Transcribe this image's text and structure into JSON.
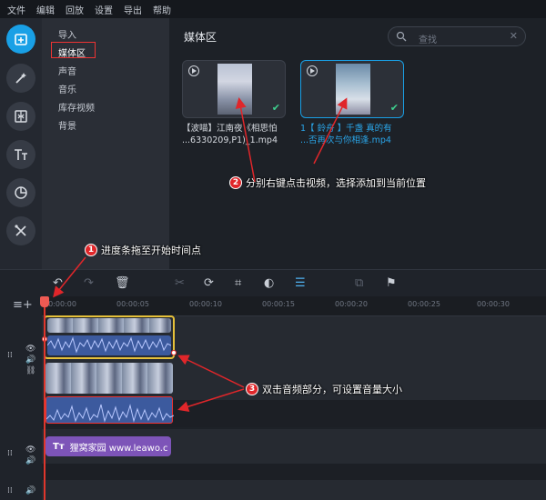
{
  "menu": [
    "文件",
    "编辑",
    "回放",
    "设置",
    "导出",
    "帮助"
  ],
  "toolbar": [
    {
      "name": "import-icon",
      "active": true
    },
    {
      "name": "magic-wand-icon",
      "active": false
    },
    {
      "name": "transitions-icon",
      "active": false
    },
    {
      "name": "titles-icon",
      "active": false
    },
    {
      "name": "filters-icon",
      "active": false
    },
    {
      "name": "tools-icon",
      "active": false
    }
  ],
  "categories": [
    "导入",
    "媒体区",
    "声音",
    "音乐",
    "库存视频",
    "背景"
  ],
  "media": {
    "title": "媒体区",
    "search_placeholder": "查找",
    "clips": [
      {
        "name_line1": "【波喵】江南夜《相思怕",
        "name_line2": "...6330209,P1)_1.mp4"
      },
      {
        "name_line1": "1【 鈴舟 】千盏 真的有",
        "name_line2": "...否再次与你相逢.mp4"
      }
    ]
  },
  "annotations": {
    "a1": {
      "num": "1",
      "text": "进度条拖至开始时间点"
    },
    "a2": {
      "num": "2",
      "text": "分别右键点击视频，选择添加到当前位置"
    },
    "a3": {
      "num": "3",
      "text": "双击音频部分，可设置音量大小"
    }
  },
  "timeline": {
    "ticks": [
      "00:00:00",
      "00:00:05",
      "00:00:10",
      "00:00:15",
      "00:00:20",
      "00:00:25",
      "00:00:30"
    ],
    "title_clip": "狸窝家园 www.leawo.c",
    "title_prefix": "Tт"
  }
}
